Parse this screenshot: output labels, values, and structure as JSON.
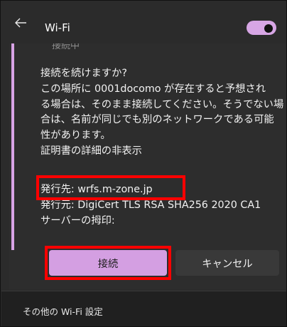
{
  "header": {
    "title": "Wi-Fi",
    "toggle_on": true
  },
  "panel": {
    "faded_previous_label": "接続中",
    "body_lines": [
      "接続を続けますか?",
      "この場所に 0001docomo が存在すると予想され",
      "る場合は、そのまま接続してください。そうでない場",
      "合は、名前が同じでも別のネットワークである可能",
      "性があります。",
      "証明書の詳細の非表示"
    ],
    "issued_to": "発行先: wrfs.m-zone.jp",
    "issued_by": "発行元: DigiCert TLS RSA SHA256 2020 CA1",
    "fingerprint_label": "サーバーの拇印:"
  },
  "buttons": {
    "connect_label": "接続",
    "cancel_label": "キャンセル"
  },
  "footer": {
    "more_settings_label": "その他の Wi-Fi 設定"
  },
  "colors": {
    "accent": "#d49fe2",
    "highlight": "#ff0000",
    "background": "#2b2b2b"
  }
}
